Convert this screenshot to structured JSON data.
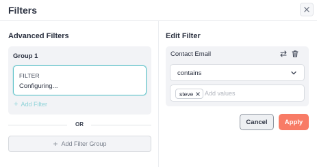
{
  "dialog": {
    "title": "Filters",
    "close_icon": "close-icon"
  },
  "advanced": {
    "title": "Advanced Filters",
    "group_label": "Group 1",
    "filter_tag": "FILTER",
    "filter_status": "Configuring...",
    "add_filter_label": "Add Filter",
    "or_label": "OR",
    "add_group_label": "Add Filter Group"
  },
  "edit": {
    "title": "Edit Filter",
    "field_name": "Contact Email",
    "operator": "contains",
    "chips": [
      "steve"
    ],
    "values_placeholder": "Add values"
  },
  "actions": {
    "cancel_label": "Cancel",
    "apply_label": "Apply"
  },
  "colors": {
    "accent_teal": "#5cc2c9",
    "apply": "#f87b66",
    "panel_bg": "#f2f3f6"
  }
}
